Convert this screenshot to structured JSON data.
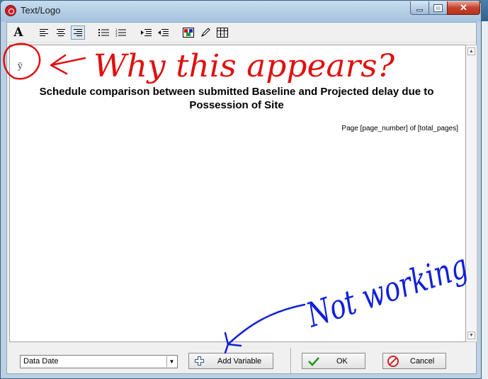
{
  "window": {
    "title": "Text/Logo"
  },
  "toolbar": {
    "items": [
      "font",
      "align-left",
      "align-center",
      "align-right",
      "bullet-list",
      "numbered-list",
      "indent",
      "outdent",
      "color",
      "pen",
      "table"
    ]
  },
  "editor": {
    "stray_char": "ÿ",
    "heading_line1": "Schedule comparison between submitted Baseline and Projected delay due to",
    "heading_line2": "Possession of Site",
    "page_label": "Page [page_number] of [total_pages]"
  },
  "bottom": {
    "variable_select_value": "Data Date",
    "add_variable_label": "Add Variable",
    "ok_label": "OK",
    "cancel_label": "Cancel"
  },
  "annotations": {
    "red_text": "Why this appears?",
    "blue_text": "Not working",
    "red_color": "#e01010",
    "blue_color": "#1020d8"
  }
}
